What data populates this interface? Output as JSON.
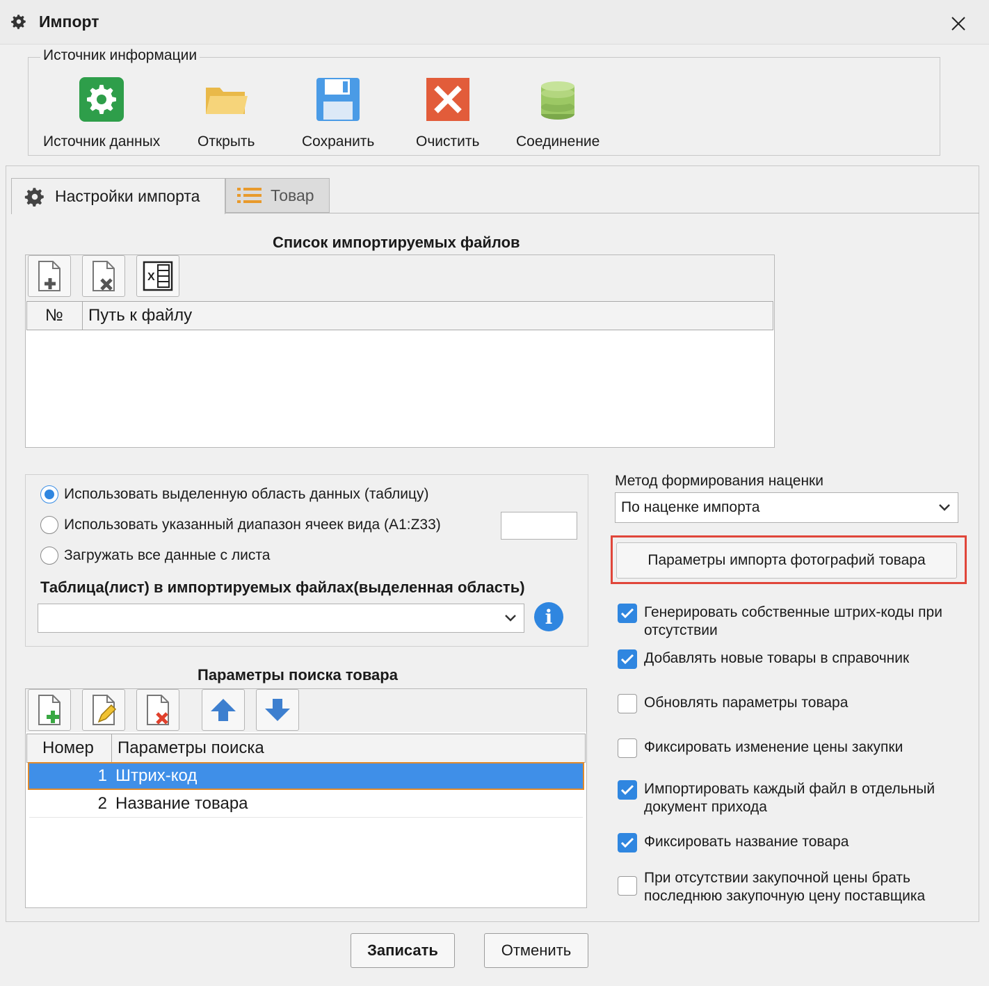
{
  "window": {
    "title": "Импорт",
    "close": "✕"
  },
  "source": {
    "legend": "Источник информации",
    "tools": [
      {
        "label": "Источник данных",
        "icon": "gear-green-icon"
      },
      {
        "label": "Открыть",
        "icon": "folder-icon"
      },
      {
        "label": "Сохранить",
        "icon": "floppy-disk-icon"
      },
      {
        "label": "Очистить",
        "icon": "clear-red-x-icon"
      },
      {
        "label": "Соединение",
        "icon": "database-icon"
      }
    ]
  },
  "tabs": [
    {
      "label": "Настройки импорта",
      "icon": "gear-icon",
      "active": true
    },
    {
      "label": "Товар",
      "icon": "list-icon",
      "active": false
    }
  ],
  "files": {
    "title": "Список импортируемых файлов",
    "columns": [
      "№",
      "Путь к файлу"
    ],
    "rows": []
  },
  "range": {
    "options": [
      {
        "label": "Использовать выделенную область данных (таблицу)",
        "selected": true
      },
      {
        "label": "Использовать указанный диапазон ячеек вида (A1:Z33)",
        "selected": false
      },
      {
        "label": "Загружать все данные с листа",
        "selected": false
      }
    ],
    "range_value": "",
    "sheet_label": "Таблица(лист) в импортируемых файлах(выделенная область)",
    "sheet_value": ""
  },
  "search": {
    "title": "Параметры поиска товара",
    "columns": [
      "Номер",
      "Параметры поиска"
    ],
    "rows": [
      {
        "num": "1",
        "value": "Штрих-код",
        "selected": true
      },
      {
        "num": "2",
        "value": "Название товара",
        "selected": false
      }
    ]
  },
  "markup": {
    "label": "Метод формирования наценки",
    "value": "По наценке импорта"
  },
  "photo_button": "Параметры импорта фотографий товара",
  "checkboxes": [
    {
      "lines": [
        "Генерировать собственные штрих-коды при",
        "отсутствии"
      ],
      "checked": true
    },
    {
      "lines": [
        "Добавлять новые товары в справочник"
      ],
      "checked": true
    },
    {
      "lines": [
        "Обновлять параметры товара"
      ],
      "checked": false
    },
    {
      "lines": [
        "Фиксировать изменение цены закупки"
      ],
      "checked": false
    },
    {
      "lines": [
        "Импортировать каждый файл в отдельный",
        "документ прихода"
      ],
      "checked": true
    },
    {
      "lines": [
        "Фиксировать название товара"
      ],
      "checked": true
    },
    {
      "lines": [
        "При отсутствии закупочной цены брать",
        "последнюю закупочную цену поставщика"
      ],
      "checked": false
    }
  ],
  "footer": {
    "save": "Записать",
    "cancel": "Отменить"
  },
  "colors": {
    "accent": "#2f86e0",
    "highlight": "#e0463a",
    "selection": "#3f8fe8"
  }
}
